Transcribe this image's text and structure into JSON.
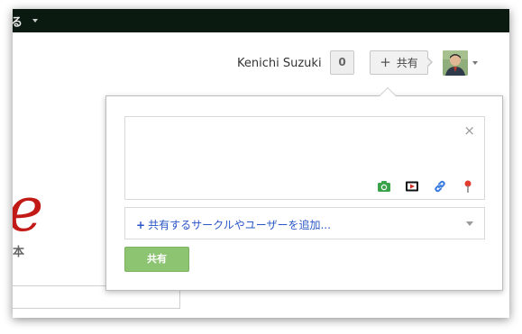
{
  "topbar": {
    "menu_label": "る"
  },
  "header": {
    "user_name": "Kenichi Suzuki",
    "notification_count": "0",
    "share_button_label": "共有",
    "share_button_icon": "+"
  },
  "background": {
    "logo_letter": "e",
    "logo_subtext": "本"
  },
  "share_box": {
    "close_symbol": "×",
    "media_icons": [
      "camera-icon",
      "video-icon",
      "link-icon",
      "location-pin-icon"
    ],
    "circles_plus": "+",
    "circles_placeholder": "共有するサークルやユーザーを追加...",
    "submit_label": "共有"
  },
  "colors": {
    "topbar_bg": "#0b1a10",
    "submit_green": "#8cc472",
    "link_blue": "#2a56c6",
    "logo_red": "#c21b17"
  }
}
